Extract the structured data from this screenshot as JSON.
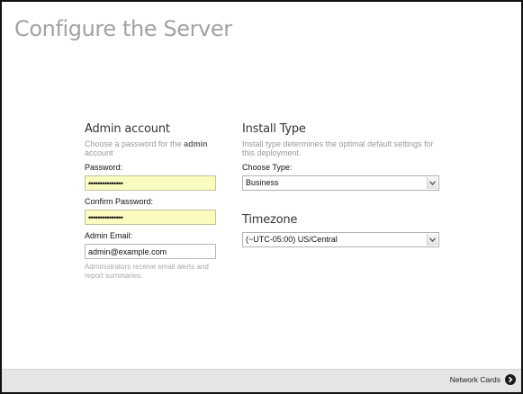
{
  "page": {
    "title": "Configure the Server"
  },
  "admin": {
    "heading": "Admin account",
    "desc_pre": "Choose a password for the ",
    "desc_bold": "admin",
    "desc_post": " account",
    "password_label": "Password:",
    "password_value": "•••••••••••••••",
    "confirm_label": "Confirm Password:",
    "confirm_value": "•••••••••••••••",
    "email_label": "Admin Email:",
    "email_value": "admin@example.com",
    "email_help": "Administrators receive email alerts and report summaries."
  },
  "install": {
    "heading": "Install Type",
    "desc": "Install type determines the optimal default settings for this deployment.",
    "type_label": "Choose Type:",
    "type_value": "Business"
  },
  "timezone": {
    "heading": "Timezone",
    "value": "(~UTC-05:00) US/Central"
  },
  "footer": {
    "next_label": "Network Cards"
  },
  "icons": {
    "select_arrow": "chevron-down-icon",
    "next": "arrow-right-circle-icon"
  },
  "colors": {
    "password_fill": "#f9fbbf",
    "footer_bg": "#e5e5e5",
    "title": "#a2a2a2"
  }
}
